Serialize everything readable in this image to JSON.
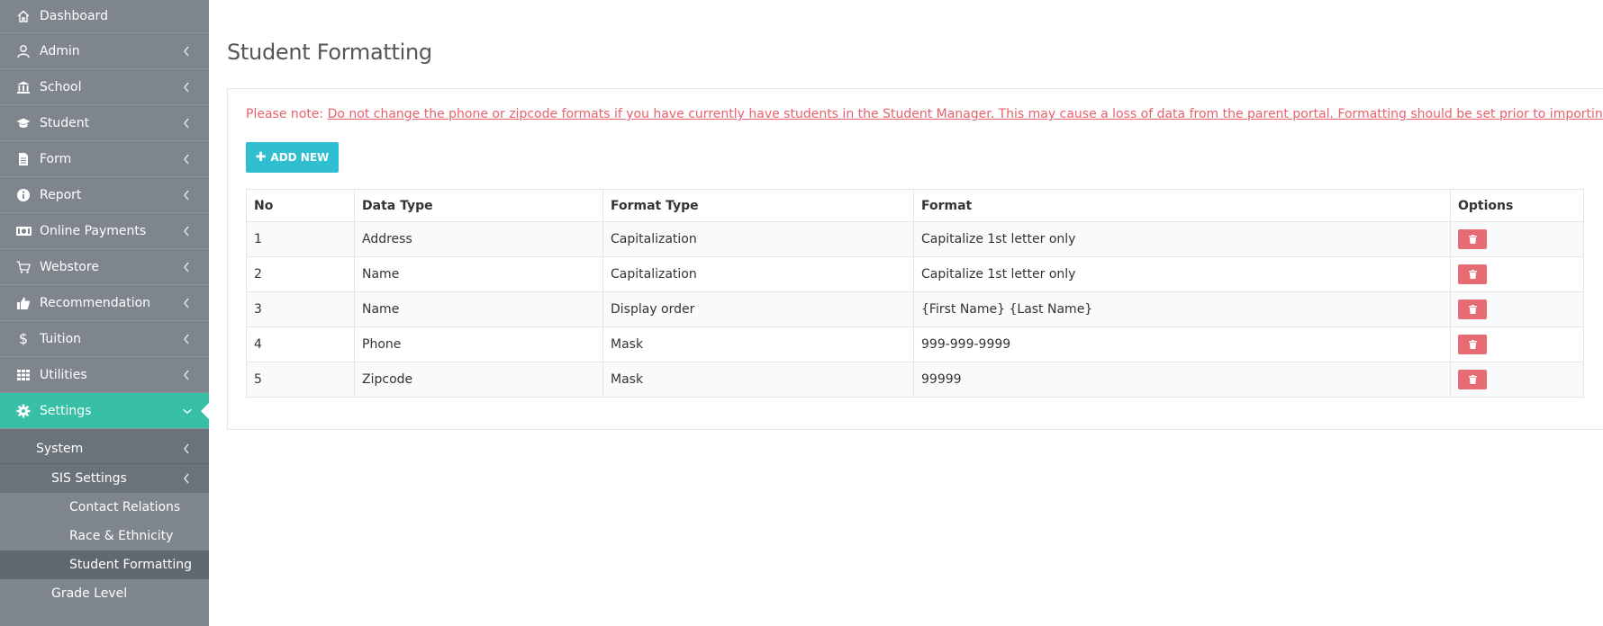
{
  "sidebar": {
    "items": [
      {
        "label": "Dashboard",
        "icon": "home-icon"
      },
      {
        "label": "Admin",
        "icon": "user-icon"
      },
      {
        "label": "School",
        "icon": "bank-icon"
      },
      {
        "label": "Student",
        "icon": "graduation-cap-icon"
      },
      {
        "label": "Form",
        "icon": "file-icon"
      },
      {
        "label": "Report",
        "icon": "info-icon"
      },
      {
        "label": "Online Payments",
        "icon": "money-icon"
      },
      {
        "label": "Webstore",
        "icon": "cart-icon"
      },
      {
        "label": "Recommendation",
        "icon": "thumbs-up-icon"
      },
      {
        "label": "Tuition",
        "icon": "dollar-icon"
      },
      {
        "label": "Utilities",
        "icon": "grid-icon"
      },
      {
        "label": "Settings",
        "icon": "gear-icon"
      }
    ],
    "submenu": {
      "system": "System",
      "sis_settings": "SIS Settings",
      "contact_relations": "Contact Relations",
      "race_ethnicity": "Race & Ethnicity",
      "student_formatting": "Student Formatting",
      "grade_level": "Grade Level"
    },
    "active_color": "#37c0a6"
  },
  "main": {
    "title": "Student Formatting",
    "note_prefix": "Please note: ",
    "note_link": "Do not change the phone or zipcode formats if you have currently have students in the Student Manager. This may cause a loss of data from the parent portal. Formatting should be set prior to importing students.",
    "add_button": "ADD NEW",
    "table": {
      "headers": [
        "No",
        "Data Type",
        "Format Type",
        "Format",
        "Options"
      ],
      "rows": [
        [
          "1",
          "Address",
          "Capitalization",
          "Capitalize 1st letter only"
        ],
        [
          "2",
          "Name",
          "Capitalization",
          "Capitalize 1st letter only"
        ],
        [
          "3",
          "Name",
          "Display order",
          "{First Name} {Last Name}"
        ],
        [
          "4",
          "Phone",
          "Mask",
          "999-999-9999"
        ],
        [
          "5",
          "Zipcode",
          "Mask",
          "99999"
        ]
      ]
    },
    "colors": {
      "note": "#e8616c",
      "add_button": "#2fbfd0",
      "delete_button": "#e66b73"
    }
  }
}
